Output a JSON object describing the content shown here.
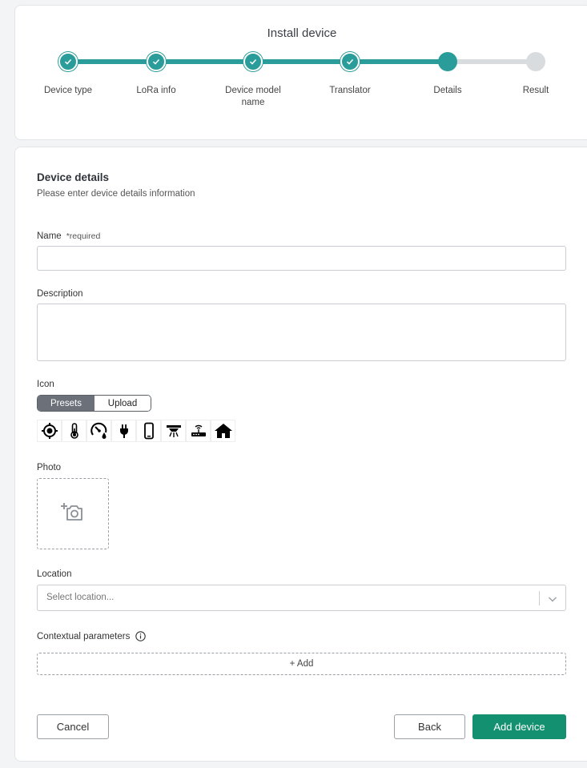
{
  "stepper": {
    "title": "Install device",
    "steps": [
      {
        "label": "Device type",
        "status": "done"
      },
      {
        "label": "LoRa info",
        "status": "done"
      },
      {
        "label": "Device model name",
        "status": "done"
      },
      {
        "label": "Translator",
        "status": "done"
      },
      {
        "label": "Details",
        "status": "current"
      },
      {
        "label": "Result",
        "status": "todo"
      }
    ],
    "colors": {
      "done": "#2a9d9a",
      "todo": "#d9dcdf"
    }
  },
  "details": {
    "title": "Device details",
    "subtitle": "Please enter device details information"
  },
  "form": {
    "name_label": "Name",
    "name_required": "*required",
    "name_value": "",
    "description_label": "Description",
    "description_value": "",
    "icon_label": "Icon",
    "icon_tabs": [
      "Presets",
      "Upload"
    ],
    "icon_presets": [
      "crosshair-icon",
      "thermometer-icon",
      "gauge-drop-icon",
      "plug-icon",
      "phone-icon",
      "ceiling-lamp-icon",
      "router-icon",
      "home-icon"
    ],
    "photo_label": "Photo",
    "location_label": "Location",
    "location_placeholder": "Select location...",
    "contextual_label": "Contextual parameters",
    "add_label": "+ Add"
  },
  "actions": {
    "cancel": "Cancel",
    "back": "Back",
    "add_device": "Add device"
  },
  "accent": "#13906f"
}
